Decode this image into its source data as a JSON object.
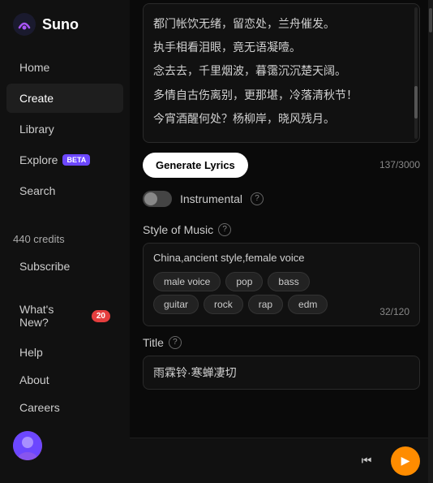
{
  "logo": {
    "text": "Suno"
  },
  "nav": {
    "items": [
      {
        "label": "Home",
        "active": false
      },
      {
        "label": "Create",
        "active": true
      },
      {
        "label": "Library",
        "active": false
      }
    ],
    "explore": {
      "label": "Explore",
      "badge": "BETA"
    },
    "search": {
      "label": "Search"
    }
  },
  "sidebar": {
    "credits": "440 credits",
    "subscribe": "Subscribe",
    "whatsNew": "What's New?",
    "whatsNewCount": "20",
    "help": "Help",
    "about": "About",
    "careers": "Careers"
  },
  "lyrics": {
    "lines": [
      "都门帐饮无绪，留恋处，兰舟催发。",
      "执手相看泪眼，竟无语凝噎。",
      "念去去，千里烟波，暮霭沉沉楚天阔。",
      "多情自古伤离别，更那堪，冷落清秋节！",
      "今宵酒醒何处？杨柳岸，晓风残月。"
    ],
    "charCount": "137/3000"
  },
  "generateLyrics": {
    "label": "Generate Lyrics"
  },
  "instrumental": {
    "label": "Instrumental"
  },
  "styleOfMusic": {
    "label": "Style of Music",
    "value": "China,ancient style,female voice",
    "charCount": "32/120",
    "tags": [
      {
        "label": "male voice"
      },
      {
        "label": "pop"
      },
      {
        "label": "bass"
      },
      {
        "label": "guitar"
      },
      {
        "label": "rock"
      },
      {
        "label": "rap"
      },
      {
        "label": "edm"
      }
    ]
  },
  "title": {
    "label": "Title",
    "value": "雨霖铃·寒蝉凄切"
  },
  "player": {
    "skipBackIcon": "⏮",
    "playIcon": "▶"
  }
}
